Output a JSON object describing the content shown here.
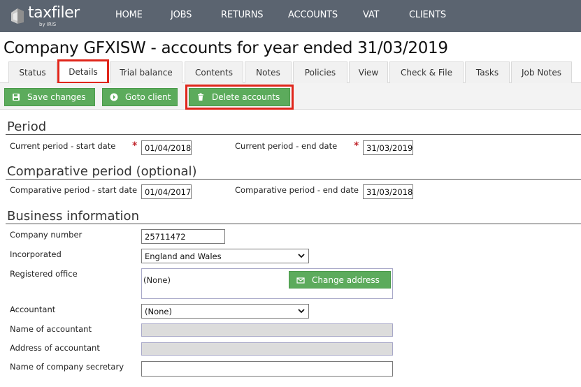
{
  "nav": {
    "logo_text": "taxfiler",
    "logo_sub": "by IRIS",
    "items": [
      "HOME",
      "JOBS",
      "RETURNS",
      "ACCOUNTS",
      "VAT",
      "CLIENTS"
    ]
  },
  "page_title": "Company GFXISW - accounts for year ended 31/03/2019",
  "tabs": [
    "Status",
    "Details",
    "Trial balance",
    "Contents",
    "Notes",
    "Policies",
    "View",
    "Check & File",
    "Tasks",
    "Job Notes"
  ],
  "active_tab": "Details",
  "toolbar": {
    "save_label": "Save changes",
    "goto_label": "Goto client",
    "delete_label": "Delete accounts"
  },
  "period": {
    "title": "Period",
    "start_label": "Current period - start date",
    "start_value": "01/04/2018",
    "end_label": "Current period - end date",
    "end_value": "31/03/2019",
    "required_mark": "*"
  },
  "comparative": {
    "title": "Comparative period (optional)",
    "start_label": "Comparative period - start date",
    "start_value": "01/04/2017",
    "end_label": "Comparative period - end date",
    "end_value": "31/03/2018"
  },
  "business": {
    "title": "Business information",
    "company_number_label": "Company number",
    "company_number_value": "25711472",
    "incorporated_label": "Incorporated",
    "incorporated_value": "England and Wales",
    "registered_office_label": "Registered office",
    "registered_office_value": "(None)",
    "change_address_label": "Change address",
    "accountant_label": "Accountant",
    "accountant_value": "(None)",
    "name_of_accountant_label": "Name of accountant",
    "name_of_accountant_value": "",
    "address_of_accountant_label": "Address of accountant",
    "address_of_accountant_value": "",
    "secretary_label": "Name of company secretary",
    "secretary_value": ""
  },
  "colors": {
    "nav_bg": "#5b6470",
    "button_green": "#5cab5c",
    "highlight_red": "#e0261b"
  }
}
